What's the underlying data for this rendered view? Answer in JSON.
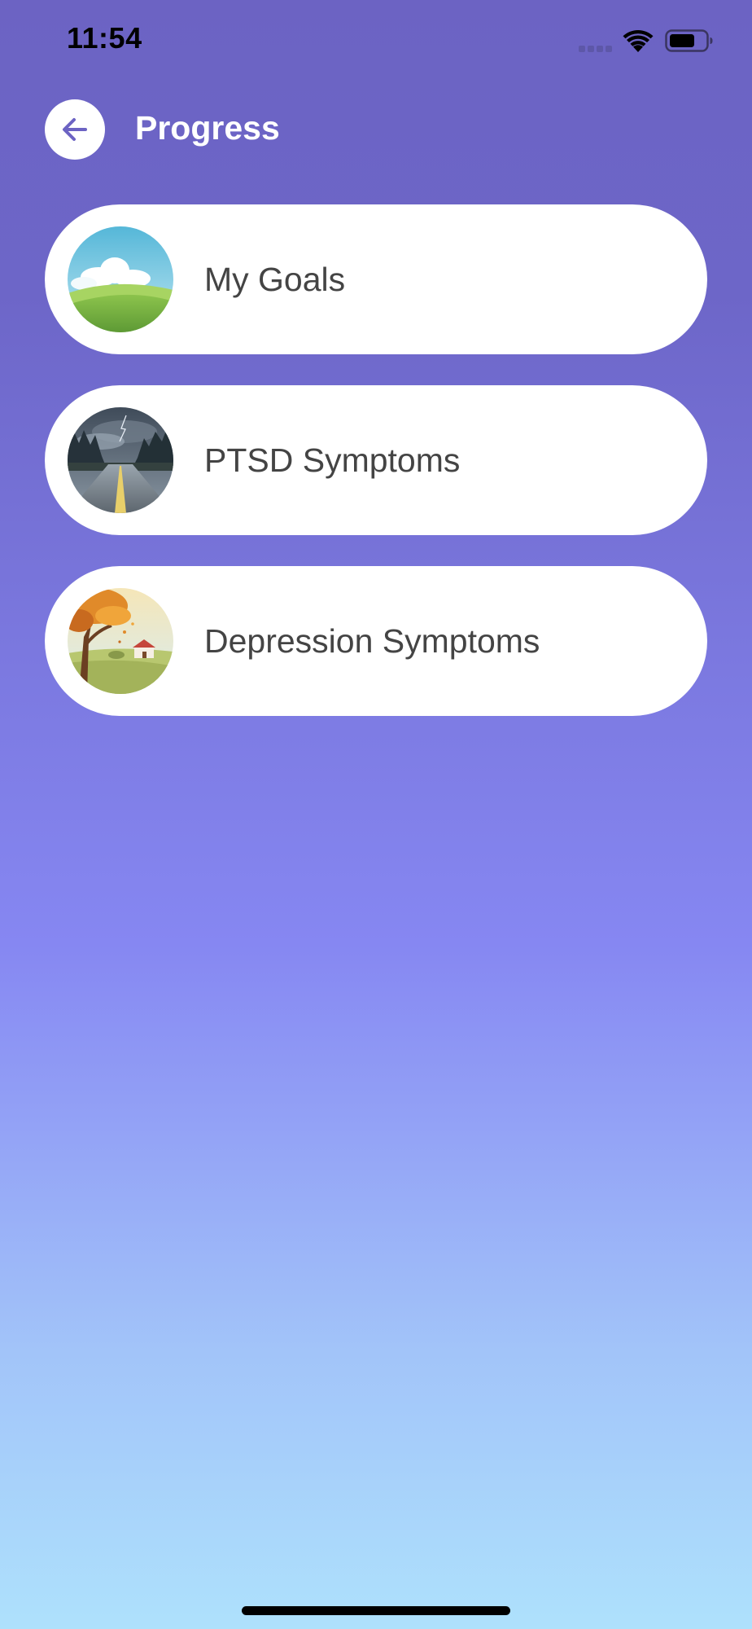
{
  "status_bar": {
    "time": "11:54"
  },
  "header": {
    "title": "Progress",
    "back_icon": "arrow-left-icon"
  },
  "menu": [
    {
      "label": "My Goals",
      "image": "green-hills-sky"
    },
    {
      "label": "PTSD Symptoms",
      "image": "stormy-forest-road"
    },
    {
      "label": "Depression Symptoms",
      "image": "autumn-tree-farmhouse"
    }
  ],
  "colors": {
    "gradient_top": "#6c63c3",
    "gradient_middle": "#8687f2",
    "gradient_bottom": "#aee1fc",
    "accent": "#6c63c3",
    "card_background": "#ffffff",
    "card_text": "#444444"
  }
}
